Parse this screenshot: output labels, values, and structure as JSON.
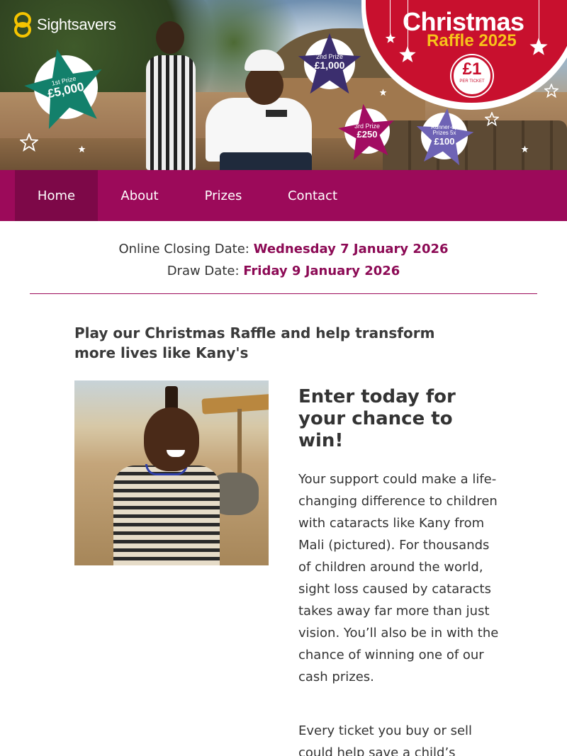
{
  "brand": {
    "name": "Sightsavers"
  },
  "raffle_badge": {
    "title": "Christmas",
    "subtitle": "Raffle 2025",
    "price": "£1",
    "price_note": "PER TICKET"
  },
  "prizes": [
    {
      "label": "1st Prize",
      "amount": "£5,000",
      "color": "#13806b"
    },
    {
      "label": "2nd Prize",
      "amount": "£1,000",
      "color": "#3b2e6e"
    },
    {
      "label": "3rd Prize",
      "amount": "£250",
      "color": "#a20c62"
    },
    {
      "label": "Runner-up Prizes 5x",
      "amount": "£100",
      "color": "#6e63b5"
    }
  ],
  "nav": {
    "items": [
      {
        "label": "Home",
        "active": true
      },
      {
        "label": "About"
      },
      {
        "label": "Prizes"
      },
      {
        "label": "Contact"
      }
    ]
  },
  "dates": {
    "closing_label": "Online Closing Date:",
    "closing_value": "Wednesday 7 January 2026",
    "draw_label": "Draw Date:",
    "draw_value": "Friday 9 January 2026"
  },
  "content": {
    "lead": "Play our Christmas Raffle and help transform more lives like Kany's",
    "heading": "Enter today for your chance to win!",
    "paragraph1": "Your support could make a life-changing difference to children with cataracts like Kany from Mali (pictured). For thousands of children around the world, sight loss caused by cataracts takes away far more than just vision. You’ll also be in with the chance of winning one of our cash prizes.",
    "paragraph2": "Every ticket you buy or sell could help save a child’s"
  },
  "colors": {
    "nav_bg": "#9c0a5a",
    "nav_active": "#7d0848",
    "date_accent": "#8c0a55",
    "badge_red": "#c8102e",
    "badge_gold": "#f7c31a",
    "logo_yellow": "#f5c400"
  }
}
